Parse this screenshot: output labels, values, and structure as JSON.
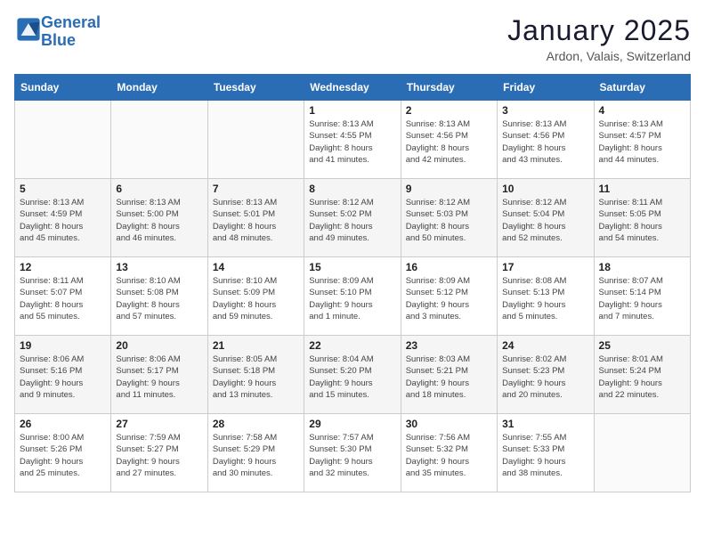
{
  "logo": {
    "line1": "General",
    "line2": "Blue"
  },
  "title": "January 2025",
  "location": "Ardon, Valais, Switzerland",
  "weekdays": [
    "Sunday",
    "Monday",
    "Tuesday",
    "Wednesday",
    "Thursday",
    "Friday",
    "Saturday"
  ],
  "weeks": [
    [
      {
        "day": "",
        "info": ""
      },
      {
        "day": "",
        "info": ""
      },
      {
        "day": "",
        "info": ""
      },
      {
        "day": "1",
        "info": "Sunrise: 8:13 AM\nSunset: 4:55 PM\nDaylight: 8 hours\nand 41 minutes."
      },
      {
        "day": "2",
        "info": "Sunrise: 8:13 AM\nSunset: 4:56 PM\nDaylight: 8 hours\nand 42 minutes."
      },
      {
        "day": "3",
        "info": "Sunrise: 8:13 AM\nSunset: 4:56 PM\nDaylight: 8 hours\nand 43 minutes."
      },
      {
        "day": "4",
        "info": "Sunrise: 8:13 AM\nSunset: 4:57 PM\nDaylight: 8 hours\nand 44 minutes."
      }
    ],
    [
      {
        "day": "5",
        "info": "Sunrise: 8:13 AM\nSunset: 4:59 PM\nDaylight: 8 hours\nand 45 minutes."
      },
      {
        "day": "6",
        "info": "Sunrise: 8:13 AM\nSunset: 5:00 PM\nDaylight: 8 hours\nand 46 minutes."
      },
      {
        "day": "7",
        "info": "Sunrise: 8:13 AM\nSunset: 5:01 PM\nDaylight: 8 hours\nand 48 minutes."
      },
      {
        "day": "8",
        "info": "Sunrise: 8:12 AM\nSunset: 5:02 PM\nDaylight: 8 hours\nand 49 minutes."
      },
      {
        "day": "9",
        "info": "Sunrise: 8:12 AM\nSunset: 5:03 PM\nDaylight: 8 hours\nand 50 minutes."
      },
      {
        "day": "10",
        "info": "Sunrise: 8:12 AM\nSunset: 5:04 PM\nDaylight: 8 hours\nand 52 minutes."
      },
      {
        "day": "11",
        "info": "Sunrise: 8:11 AM\nSunset: 5:05 PM\nDaylight: 8 hours\nand 54 minutes."
      }
    ],
    [
      {
        "day": "12",
        "info": "Sunrise: 8:11 AM\nSunset: 5:07 PM\nDaylight: 8 hours\nand 55 minutes."
      },
      {
        "day": "13",
        "info": "Sunrise: 8:10 AM\nSunset: 5:08 PM\nDaylight: 8 hours\nand 57 minutes."
      },
      {
        "day": "14",
        "info": "Sunrise: 8:10 AM\nSunset: 5:09 PM\nDaylight: 8 hours\nand 59 minutes."
      },
      {
        "day": "15",
        "info": "Sunrise: 8:09 AM\nSunset: 5:10 PM\nDaylight: 9 hours\nand 1 minute."
      },
      {
        "day": "16",
        "info": "Sunrise: 8:09 AM\nSunset: 5:12 PM\nDaylight: 9 hours\nand 3 minutes."
      },
      {
        "day": "17",
        "info": "Sunrise: 8:08 AM\nSunset: 5:13 PM\nDaylight: 9 hours\nand 5 minutes."
      },
      {
        "day": "18",
        "info": "Sunrise: 8:07 AM\nSunset: 5:14 PM\nDaylight: 9 hours\nand 7 minutes."
      }
    ],
    [
      {
        "day": "19",
        "info": "Sunrise: 8:06 AM\nSunset: 5:16 PM\nDaylight: 9 hours\nand 9 minutes."
      },
      {
        "day": "20",
        "info": "Sunrise: 8:06 AM\nSunset: 5:17 PM\nDaylight: 9 hours\nand 11 minutes."
      },
      {
        "day": "21",
        "info": "Sunrise: 8:05 AM\nSunset: 5:18 PM\nDaylight: 9 hours\nand 13 minutes."
      },
      {
        "day": "22",
        "info": "Sunrise: 8:04 AM\nSunset: 5:20 PM\nDaylight: 9 hours\nand 15 minutes."
      },
      {
        "day": "23",
        "info": "Sunrise: 8:03 AM\nSunset: 5:21 PM\nDaylight: 9 hours\nand 18 minutes."
      },
      {
        "day": "24",
        "info": "Sunrise: 8:02 AM\nSunset: 5:23 PM\nDaylight: 9 hours\nand 20 minutes."
      },
      {
        "day": "25",
        "info": "Sunrise: 8:01 AM\nSunset: 5:24 PM\nDaylight: 9 hours\nand 22 minutes."
      }
    ],
    [
      {
        "day": "26",
        "info": "Sunrise: 8:00 AM\nSunset: 5:26 PM\nDaylight: 9 hours\nand 25 minutes."
      },
      {
        "day": "27",
        "info": "Sunrise: 7:59 AM\nSunset: 5:27 PM\nDaylight: 9 hours\nand 27 minutes."
      },
      {
        "day": "28",
        "info": "Sunrise: 7:58 AM\nSunset: 5:29 PM\nDaylight: 9 hours\nand 30 minutes."
      },
      {
        "day": "29",
        "info": "Sunrise: 7:57 AM\nSunset: 5:30 PM\nDaylight: 9 hours\nand 32 minutes."
      },
      {
        "day": "30",
        "info": "Sunrise: 7:56 AM\nSunset: 5:32 PM\nDaylight: 9 hours\nand 35 minutes."
      },
      {
        "day": "31",
        "info": "Sunrise: 7:55 AM\nSunset: 5:33 PM\nDaylight: 9 hours\nand 38 minutes."
      },
      {
        "day": "",
        "info": ""
      }
    ]
  ]
}
